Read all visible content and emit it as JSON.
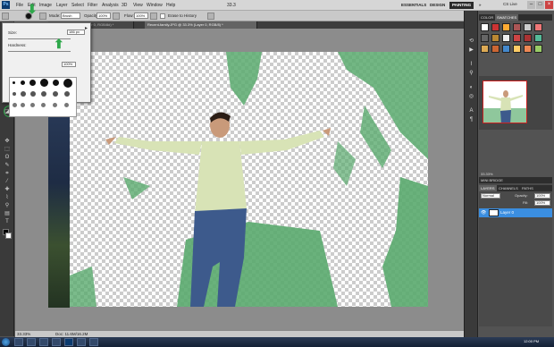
{
  "app": {
    "logo": "Ps"
  },
  "menu": [
    "File",
    "Edit",
    "Image",
    "Layer",
    "Select",
    "Filter",
    "Analysis",
    "3D",
    "View",
    "Window",
    "Help"
  ],
  "zoom_menu": "33.3",
  "workspaces": {
    "essentials": "ESSENTIALS",
    "design": "DESIGN",
    "painting": "PAINTING",
    "more": "»"
  },
  "cs_live": "CS Live",
  "options": {
    "mode_label": "Mode:",
    "mode_value": "Brush",
    "opacity_label": "Opacity:",
    "opacity_value": "100%",
    "flow_label": "Flow:",
    "flow_value": "100%",
    "erase_history": "Erase to History"
  },
  "tabs": [
    {
      "label": "photo.jpg @ 33.3% (Layer 0, RGB/8#) *",
      "active": false
    },
    {
      "label": "Recent-family.JPG @ 33.3% (Layer 0, RGB/8) *",
      "active": true
    }
  ],
  "brush_popup": {
    "size_label": "Size:",
    "size_value": "186 px",
    "hardness_label": "Hardness:",
    "hardness_value": "100%"
  },
  "status": {
    "zoom": "33.33%",
    "doc": "Doc: 11.6M/16.2M"
  },
  "panels": {
    "swatches_tabs": [
      "COLOR",
      "SWATCHES"
    ],
    "styles_tab": "STYLES",
    "navigator_zoom": "33.33%",
    "layers_tabs": [
      "LAYERS",
      "CHANNELS",
      "PATHS"
    ],
    "blend_mode": "Normal",
    "opacity_label": "Opacity:",
    "opacity_value": "100%",
    "fill_label": "Fill:",
    "fill_value": "100%",
    "layer_name": "Layer 0",
    "mini_bridge": "MINI BRIDGE"
  },
  "taskbar": {
    "clock": "12:00 PM"
  },
  "colors": {
    "accent_green": "#2ea84b",
    "layer_selected": "#3b8ee0",
    "ps_blue": "#0b3a6e"
  }
}
